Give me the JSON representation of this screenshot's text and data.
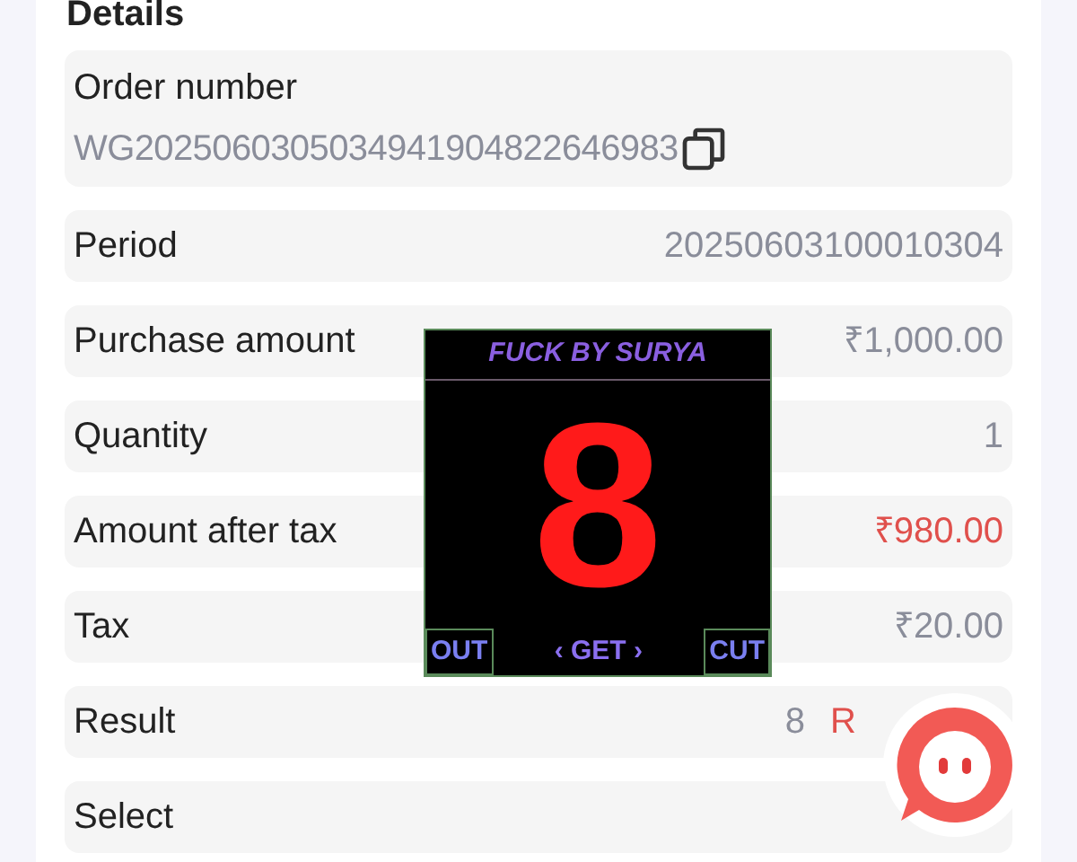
{
  "section_title": "Details",
  "order": {
    "label": "Order number",
    "value": "WG2025060305034941904822646983"
  },
  "rows": [
    {
      "label": "Period",
      "values": [
        {
          "text": "20250603100010304",
          "highlighted": false
        }
      ]
    },
    {
      "label": "Purchase amount",
      "values": [
        {
          "text": "₹1,000.00",
          "highlighted": false
        }
      ]
    },
    {
      "label": "Quantity",
      "values": [
        {
          "text": "1",
          "highlighted": false
        }
      ]
    },
    {
      "label": "Amount after tax",
      "values": [
        {
          "text": "₹980.00",
          "highlighted": true
        }
      ]
    },
    {
      "label": "Tax",
      "values": [
        {
          "text": "₹20.00",
          "highlighted": false
        }
      ]
    },
    {
      "label": "Result",
      "values": [
        {
          "text": "8",
          "highlighted": false
        },
        {
          "text": "R",
          "highlighted": true
        }
      ]
    },
    {
      "label": "Select",
      "values": []
    }
  ],
  "overlay": {
    "title": "FUCK BY SURYA",
    "number": "8",
    "buttons": [
      "OUT",
      "‹ GET ›",
      "CUT"
    ]
  }
}
